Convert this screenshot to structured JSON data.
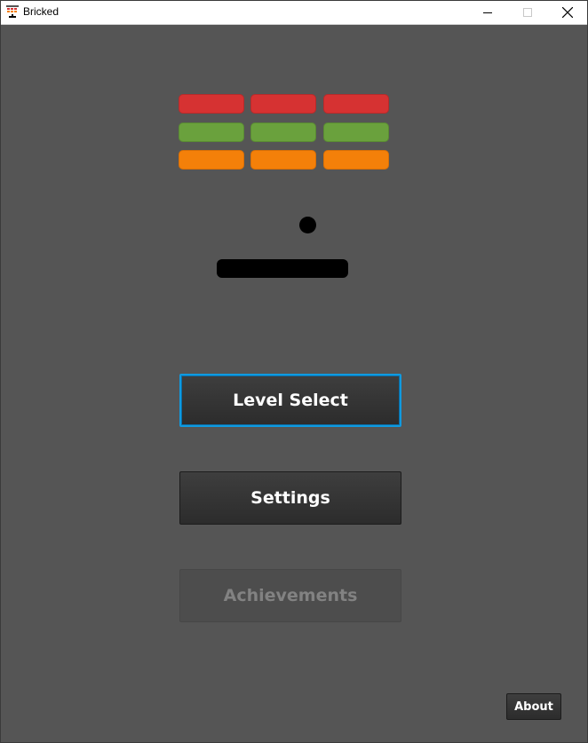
{
  "window": {
    "title": "Bricked",
    "app_icon": "brick-wall-icon",
    "controls": [
      "minimize-icon",
      "maximize-icon",
      "close-icon"
    ]
  },
  "game_preview": {
    "brick_rows": [
      {
        "color": "#d63232",
        "count": 3
      },
      {
        "color": "#6aa13d",
        "count": 3
      },
      {
        "color": "#f48009",
        "count": 3
      }
    ],
    "ball_color": "#000000",
    "paddle_color": "#000000"
  },
  "menu": {
    "level_select_label": "Level Select",
    "settings_label": "Settings",
    "achievements_label": "Achievements",
    "about_label": "About"
  },
  "colors": {
    "background": "#555555",
    "focus_ring": "#0f9ae0",
    "disabled_text": "#828282"
  }
}
